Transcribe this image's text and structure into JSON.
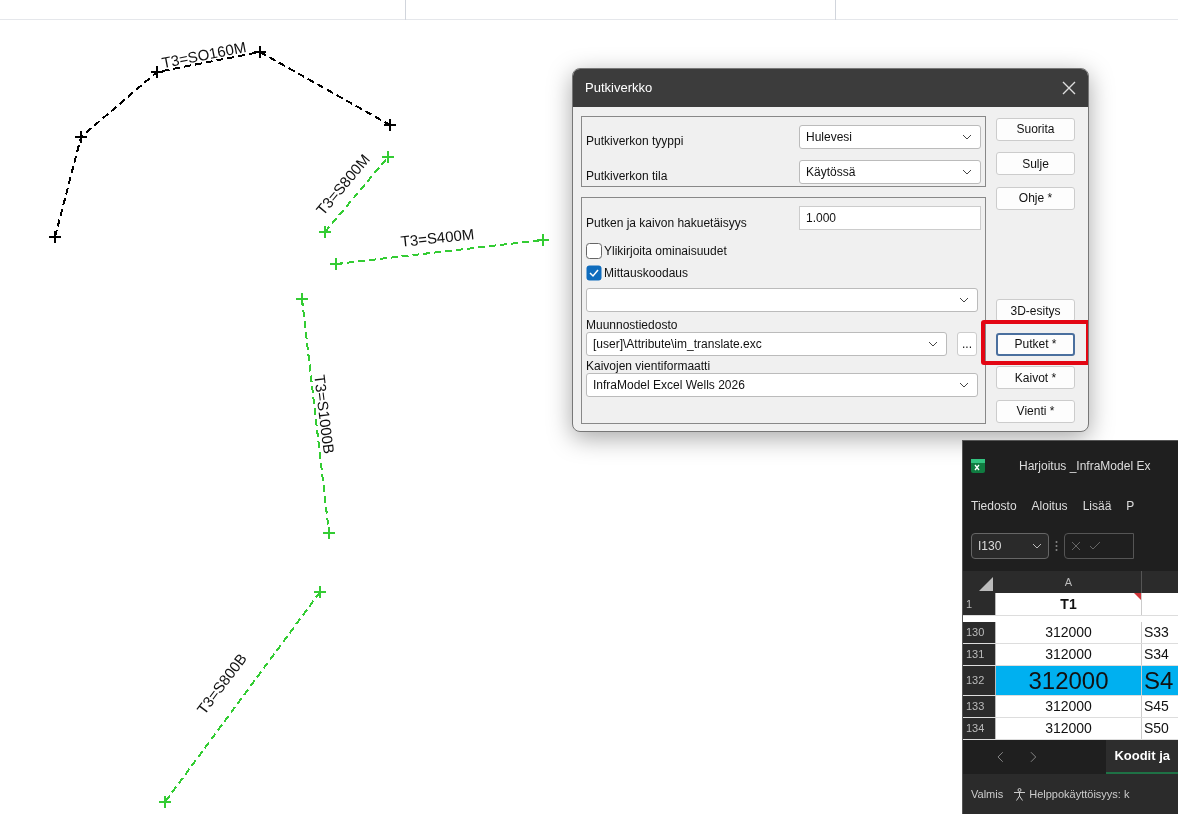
{
  "drawing": {
    "pipes": [
      {
        "label": "T3=SO160M",
        "color": "#000000"
      },
      {
        "label": "T3=S800M",
        "color": "#33cc33"
      },
      {
        "label": "T3=S400M",
        "color": "#33cc33"
      },
      {
        "label": "T3=S1000B",
        "color": "#33cc33"
      },
      {
        "label": "T3=S800B",
        "color": "#33cc33"
      }
    ]
  },
  "dialog": {
    "title": "Putkiverkko",
    "network_fields": [
      {
        "label": "Putkiverkon tyyppi",
        "value": "Hulevesi"
      },
      {
        "label": "Putkiverkon tila",
        "value": "Käytössä"
      }
    ],
    "search_distance": {
      "label": "Putken ja kaivon hakuetäisyys",
      "value": "1.000"
    },
    "checkboxes": [
      {
        "label": "Ylikirjoita ominaisuudet",
        "checked": false
      },
      {
        "label": "Mittauskoodaus",
        "checked": true
      }
    ],
    "conversion_file": {
      "label": "Muunnostiedosto",
      "value": "[user]\\Attribute\\im_translate.exc",
      "browse": "..."
    },
    "export_format": {
      "label": "Kaivojen vientiformaatti",
      "value": "InfraModel Excel Wells 2026"
    },
    "buttons_top": [
      {
        "label": "Suorita",
        "highlighted": false
      },
      {
        "label": "Sulje",
        "highlighted": false
      },
      {
        "label": "Ohje *",
        "highlighted": false
      }
    ],
    "buttons_bottom": [
      {
        "label": "3D-esitys",
        "highlighted": false
      },
      {
        "label": "Putket *",
        "highlighted": true
      },
      {
        "label": "Kaivot *",
        "highlighted": false
      },
      {
        "label": "Vienti *",
        "highlighted": false
      }
    ]
  },
  "excel": {
    "title": "Harjoitus _InfraModel Ex",
    "menu": [
      "Tiedosto",
      "Aloitus",
      "Lisää",
      "P"
    ],
    "name_box": "I130",
    "columns": [
      "A"
    ],
    "header_row": {
      "number": "1",
      "cells": [
        "T1"
      ]
    },
    "rows": [
      {
        "number": "130",
        "cells": [
          "312000",
          "S33"
        ],
        "selected": false
      },
      {
        "number": "131",
        "cells": [
          "312000",
          "S34"
        ],
        "selected": false
      },
      {
        "number": "132",
        "cells": [
          "312000",
          "S4"
        ],
        "selected": true
      },
      {
        "number": "133",
        "cells": [
          "312000",
          "S45"
        ],
        "selected": false
      },
      {
        "number": "134",
        "cells": [
          "312000",
          "S50"
        ],
        "selected": false
      }
    ],
    "sheet_tab": "Koodit ja",
    "status": "Valmis",
    "accessibility": "Helppokäyttöisyys: k"
  }
}
